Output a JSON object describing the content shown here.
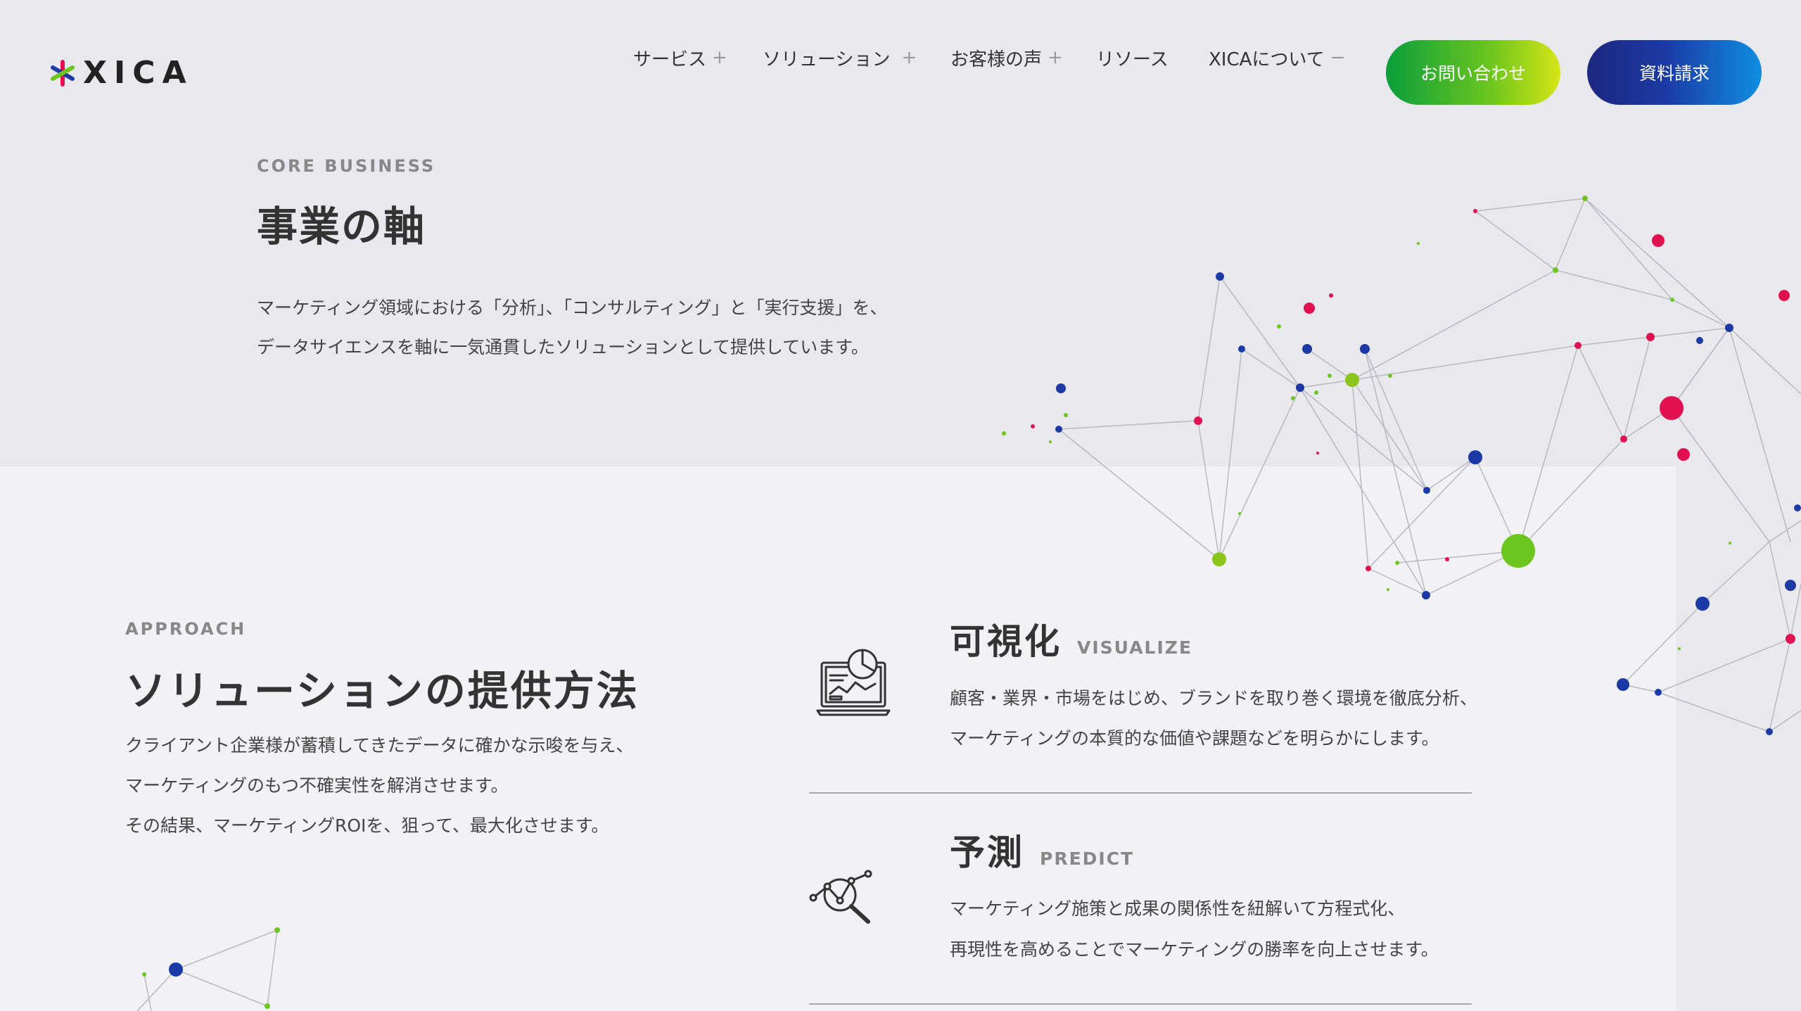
{
  "brand": {
    "logo_text": "XICA",
    "colors": {
      "green": "#0a9e3c",
      "lime": "#d7e616",
      "navy": "#1d2780",
      "blue": "#0f8ee0",
      "magenta": "#e0114e"
    }
  },
  "nav": {
    "items": [
      {
        "label": "サービス",
        "toggle": "+"
      },
      {
        "label": "ソリューション",
        "toggle": "+"
      },
      {
        "label": "お客様の声",
        "toggle": "+"
      },
      {
        "label": "リソース",
        "toggle": ""
      },
      {
        "label": "XICAについて",
        "toggle": "−"
      }
    ],
    "contact_label": "お問い合わせ",
    "docs_label": "資料請求"
  },
  "core": {
    "eyebrow": "CORE BUSINESS",
    "title": "事業の軸",
    "lines": [
      "マーケティング領域における「分析」、「コンサルティング」と「実行支援」を、",
      "データサイエンスを軸に一気通貫したソリューションとして提供しています。"
    ]
  },
  "approach": {
    "eyebrow": "APPROACH",
    "title": "ソリューションの提供方法",
    "lines": [
      "クライアント企業様が蓄積してきたデータに確かな示唆を与え、",
      "マーケティングのもつ不確実性を解消させます。",
      "その結果、マーケティングROIを、狙って、最大化させます。"
    ]
  },
  "features": [
    {
      "title": "可視化",
      "en": "VISUALIZE",
      "icon": "dashboard-laptop-icon",
      "lines": [
        "顧客・業界・市場をはじめ、ブランドを取り巻く環境を徹底分析、",
        "マーケティングの本質的な価値や課題などを明らかにします。"
      ]
    },
    {
      "title": "予測",
      "en": "PREDICT",
      "icon": "magnifier-graph-icon",
      "lines": [
        "マーケティング施策と成果の関係性を紐解いて方程式化、",
        "再現性を高めることでマーケティングの勝率を向上させます。"
      ]
    }
  ]
}
